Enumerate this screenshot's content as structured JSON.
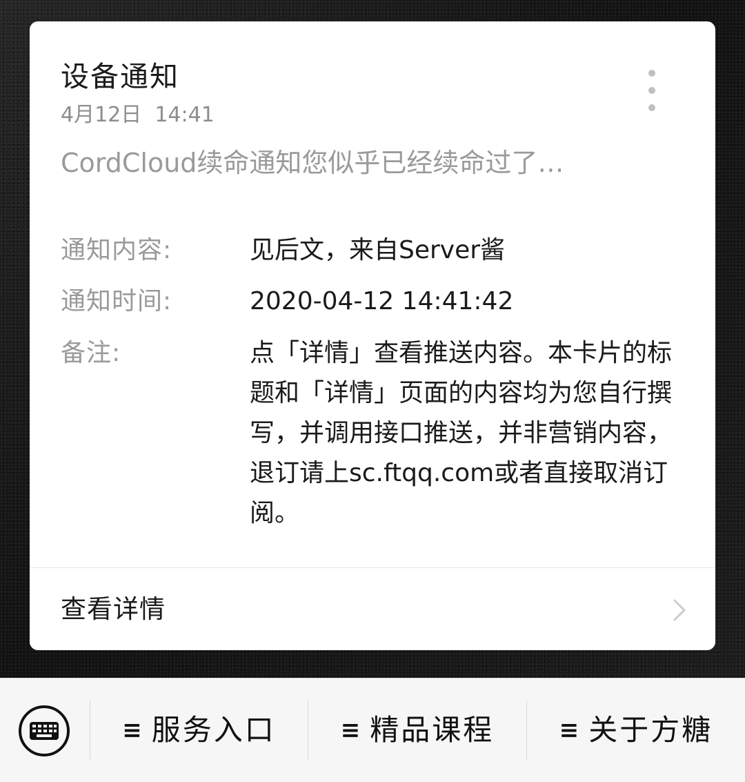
{
  "card": {
    "title": "设备通知",
    "date": "4月12日  14:41",
    "preview": "CordCloud续命通知您似乎已经续命过了…",
    "more_icon": "more-vertical-icon",
    "fields": [
      {
        "label": "通知内容:",
        "value": "见后文，来自Server酱"
      },
      {
        "label": "通知时间:",
        "value": "2020-04-12 14:41:42"
      },
      {
        "label": "备注:",
        "value": "点「详情」查看推送内容。本卡片的标题和「详情」页面的内容均为您自行撰写，并调用接口推送，并非营销内容，退订请上sc.ftqq.com或者直接取消订阅。"
      }
    ],
    "detail_label": "查看详情",
    "detail_icon": "chevron-right-icon"
  },
  "bottom_bar": {
    "keyboard_icon": "keyboard-icon",
    "menus": [
      {
        "icon_glyph": "≡",
        "icon": "menu-icon",
        "label": "服务入口"
      },
      {
        "icon_glyph": "≡",
        "icon": "menu-icon",
        "label": "精品课程"
      },
      {
        "icon_glyph": "≡",
        "icon": "menu-icon",
        "label": "关于方糖"
      }
    ]
  },
  "colors": {
    "background": "#151515",
    "card": "#ffffff",
    "text_primary": "#1a1a1a",
    "text_secondary": "#9a9a9a",
    "bottom_bar": "#f6f6f6"
  }
}
